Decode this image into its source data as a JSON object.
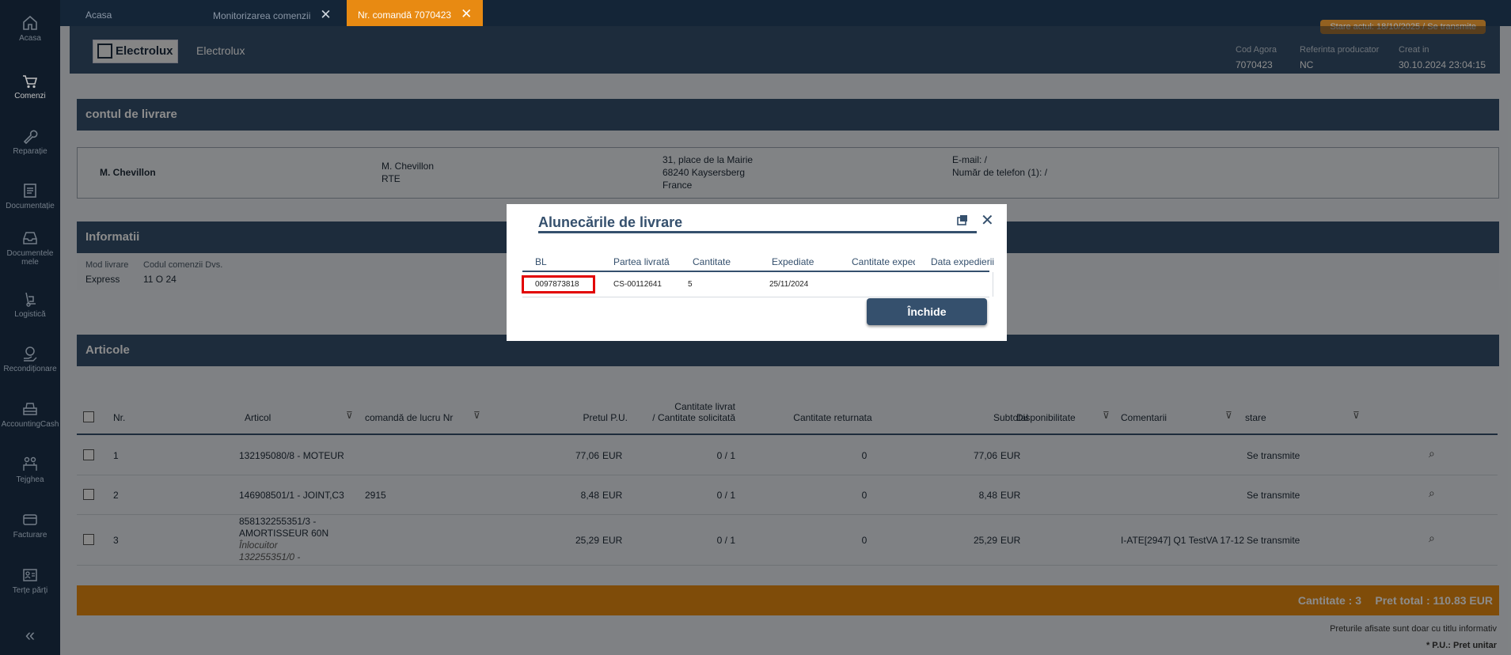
{
  "sidebar": {
    "items": [
      {
        "label": "Acasa",
        "icon": "home-icon"
      },
      {
        "label": "Comenzi",
        "icon": "cart-icon"
      },
      {
        "label": "Reparație",
        "icon": "wrench-icon"
      },
      {
        "label": "Documentație",
        "icon": "document-icon"
      },
      {
        "label": "Documentele mele",
        "icon": "inbox-icon"
      },
      {
        "label": "Logistică",
        "icon": "hand-truck-icon"
      },
      {
        "label": "Recondiționare",
        "icon": "recycle-hand-icon"
      },
      {
        "label": "AccountingCash",
        "icon": "register-icon"
      },
      {
        "label": "Tejghea",
        "icon": "counter-icon"
      },
      {
        "label": "Facturare",
        "icon": "card-icon"
      },
      {
        "label": "Terțe părți",
        "icon": "id-card-icon"
      }
    ],
    "collapse_label": "«"
  },
  "tabs": [
    {
      "label": "Acasa"
    },
    {
      "label": "Monitorizarea comenzii"
    },
    {
      "label": "Nr. comandă 7070423"
    }
  ],
  "header": {
    "logo_text": "Electrolux",
    "brand": "Electrolux",
    "stare": "Stare actul: 18/10/2025 / Se transmite",
    "cod_agora_label": "Cod Agora",
    "cod_agora": "7070423",
    "referinta_label": "Referinta producator",
    "referinta": "NC",
    "creat_label": "Creat in",
    "creat": "30.10.2024 23:04:15"
  },
  "delivery": {
    "title": "contul de livrare",
    "name": "M. Chevillon",
    "contact_line1": "M. Chevillon",
    "contact_line2": "RTE",
    "addr1": "31, place de la Mairie",
    "addr2": "68240 Kaysersberg",
    "addr3": "France",
    "email": "E-mail: /",
    "phone": "Număr de telefon (1): /"
  },
  "info": {
    "title": "Informatii",
    "mod_livrare_label": "Mod livrare",
    "mod_livrare": "Express",
    "cod_comenzii_label": "Codul comenzii Dvs.",
    "cod_comenzii": "11 O 24"
  },
  "articles": {
    "title": "Articole",
    "headers": {
      "nr": "Nr.",
      "articol": "Articol",
      "comanda": "comandă de lucru Nr",
      "pret": "Pretul P.U.",
      "cant_livr1": "Cantitate livrat",
      "cant_livr2": "/ Cantitate solicitată",
      "cant_ret": "Cantitate returnata",
      "subtotal": "Subtotal",
      "disp": "Disponibilitate",
      "coment": "Comentarii",
      "stare": "stare"
    },
    "rows": [
      {
        "nr": "1",
        "articol": "132195080/8 - MOTEUR",
        "articol2": "",
        "articol3": "",
        "articol4": "",
        "comanda": "",
        "pret": "77,06",
        "cur": "EUR",
        "cant": "0 /  1",
        "ret": "0",
        "sub": "77,06",
        "sub_cur": "EUR",
        "coment": "",
        "stare": "Se transmite"
      },
      {
        "nr": "2",
        "articol": "146908501/1 - JOINT,C3",
        "articol2": "",
        "articol3": "",
        "articol4": "",
        "comanda": "2915",
        "pret": "8,48",
        "cur": "EUR",
        "cant": "0 /  1",
        "ret": "0",
        "sub": "8,48",
        "sub_cur": "EUR",
        "coment": "",
        "stare": "Se transmite"
      },
      {
        "nr": "3",
        "articol": "858132255351/3 -",
        "articol2": "AMORTISSEUR  60N",
        "articol3": "Înlocuitor",
        "articol4": "132255351/0 -",
        "comanda": "",
        "pret": "25,29",
        "cur": "EUR",
        "cant": "0 /  1",
        "ret": "0",
        "sub": "25,29",
        "sub_cur": "EUR",
        "coment": "I-ATE[2947] Q1 TestVA 17-12",
        "stare": "Se transmite"
      }
    ]
  },
  "totals": {
    "cantitate": "Cantitate : 3",
    "pret_total": "Pret total : 110.83  EUR",
    "note1": "Preturile afisate sunt doar cu titlu informativ",
    "note2": "* P.U.: Pret unitar"
  },
  "modal": {
    "title": "Alunecările de livrare",
    "headers": [
      "BL",
      "Partea livrată",
      "Cantitate",
      "Expediate",
      "Cantitate expediată",
      "Data expedierii"
    ],
    "row": {
      "bl": "0097873818",
      "partea": "CS-00112641",
      "cantitate": "5",
      "expediate": "25/11/2024",
      "cant_exp": "",
      "data_exp": ""
    },
    "close_label": "Închide",
    "highlight_color": "#e20000"
  },
  "colors": {
    "navy": "#35506d",
    "orange": "#e88a12",
    "sidebar": "#142537"
  }
}
